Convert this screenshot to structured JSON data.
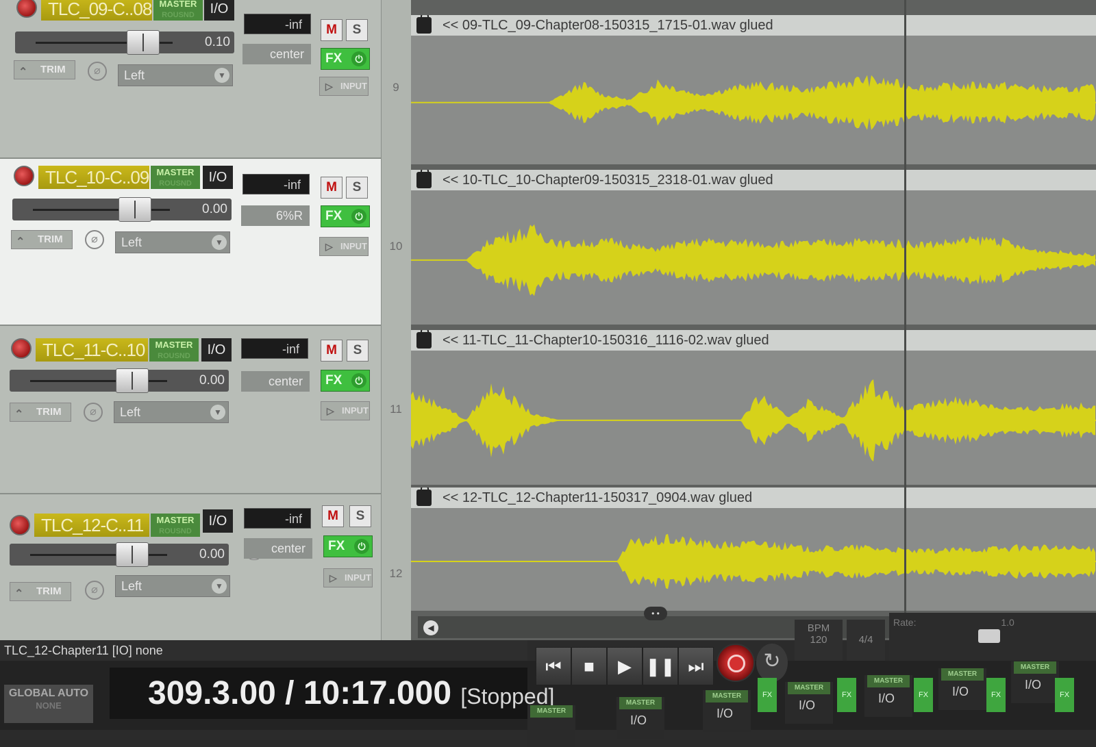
{
  "tracks": [
    {
      "name": "TLC_09-C..08",
      "master_label": "MASTER",
      "master_sub": "ROUSND",
      "io_label": "I/O",
      "volume_display": "-inf",
      "fader_value": "0.10",
      "fader_pct": 0.55,
      "pan_value": "center",
      "mute_label": "M",
      "solo_label": "S",
      "fx_label": "FX",
      "trim_label": "TRIM",
      "rec_input": "Left",
      "input_label": "INPUT",
      "number": "9",
      "selected": false,
      "item_label": "<< 09-TLC_09-Chapter08-150315_1715-01.wav glued"
    },
    {
      "name": "TLC_10-C..09",
      "master_label": "MASTER",
      "master_sub": "ROUSND",
      "io_label": "I/O",
      "volume_display": "-inf",
      "fader_value": "0.00",
      "fader_pct": 0.52,
      "pan_value": "6%R",
      "mute_label": "M",
      "solo_label": "S",
      "fx_label": "FX",
      "trim_label": "TRIM",
      "rec_input": "Left",
      "input_label": "INPUT",
      "number": "10",
      "selected": true,
      "item_label": "<< 10-TLC_10-Chapter09-150315_2318-01.wav glued"
    },
    {
      "name": "TLC_11-C..10",
      "master_label": "MASTER",
      "master_sub": "ROUSND",
      "io_label": "I/O",
      "volume_display": "-inf",
      "fader_value": "0.00",
      "fader_pct": 0.52,
      "pan_value": "center",
      "mute_label": "M",
      "solo_label": "S",
      "fx_label": "FX",
      "trim_label": "TRIM",
      "rec_input": "Left",
      "input_label": "INPUT",
      "number": "11",
      "selected": false,
      "item_label": "<< 11-TLC_11-Chapter10-150316_1116-02.wav glued"
    },
    {
      "name": "TLC_12-C..11",
      "master_label": "MASTER",
      "master_sub": "ROUSND",
      "io_label": "I/O",
      "volume_display": "-inf",
      "fader_value": "0.00",
      "fader_pct": 0.52,
      "pan_value": "center",
      "mute_label": "M",
      "solo_label": "S",
      "fx_label": "FX",
      "trim_label": "TRIM",
      "rec_input": "Left",
      "input_label": "INPUT",
      "number": "12",
      "selected": false,
      "item_label": "<< 12-TLC_12-Chapter11-150317_0904.wav glued"
    }
  ],
  "status_bar": {
    "text": "TLC_12-Chapter11 [IO] none"
  },
  "transport": {
    "position": "309.3.00 / 10:17.000",
    "state": "[Stopped]",
    "global_auto": "GLOBAL AUTO",
    "global_auto_sub": "NONE",
    "bpm_label": "BPM",
    "bpm_value": "120",
    "time_signature": "4/4",
    "rate_label": "Rate:",
    "rate_value": "1.0",
    "buttons": [
      "skip-to-start",
      "stop",
      "play",
      "pause",
      "skip-to-end"
    ]
  },
  "mixer": {
    "master_label": "MASTER",
    "io_label": "I/O",
    "fx_label": "FX"
  },
  "colors": {
    "waveform": "#d6d21a",
    "track_name_bg": "#bcae14",
    "fx_green": "#3fbf3f",
    "mute_red": "#c01010"
  }
}
